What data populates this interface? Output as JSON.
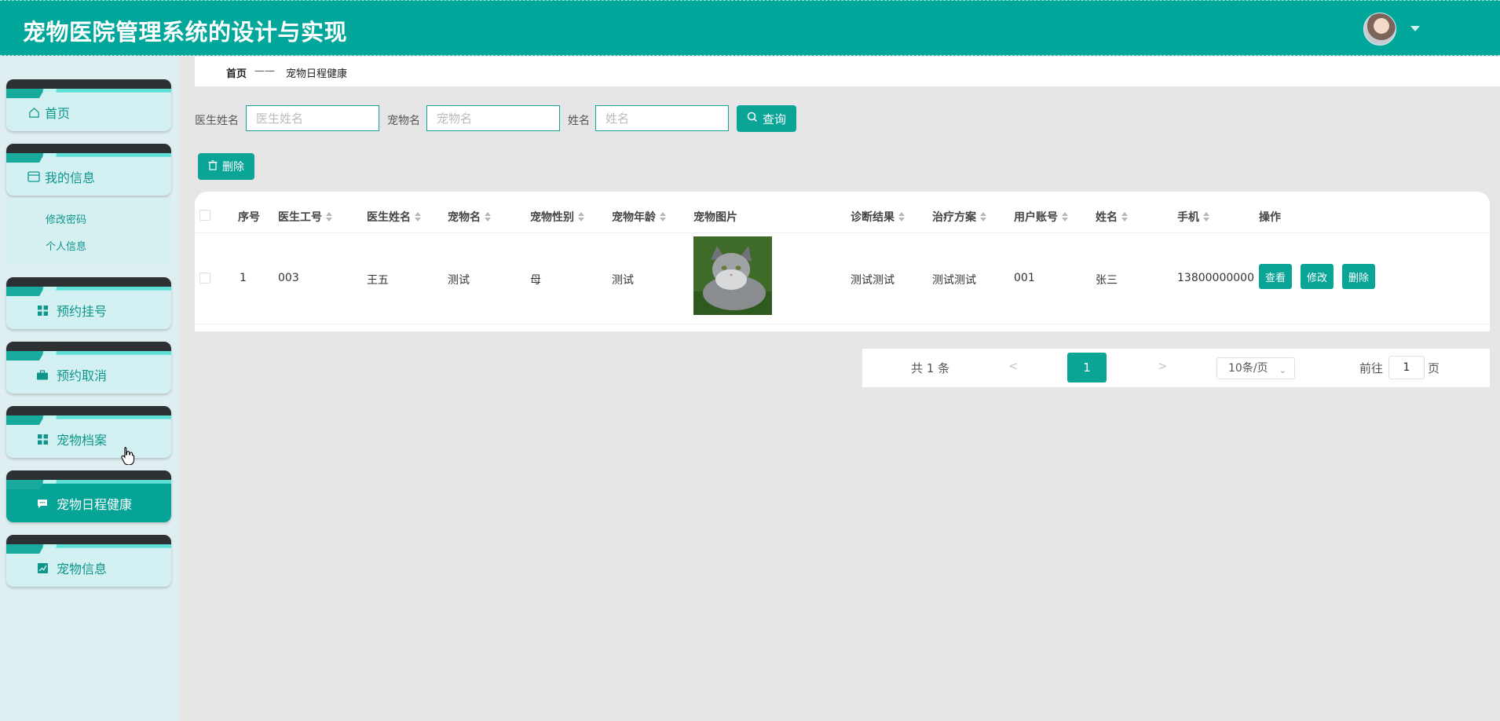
{
  "header": {
    "title": "宠物医院管理系统的设计与实现"
  },
  "sidebar": {
    "items": [
      {
        "label": "首页",
        "icon": "home-icon"
      },
      {
        "label": "我的信息",
        "icon": "wallet-icon"
      },
      {
        "label": "预约挂号",
        "icon": "grid-icon"
      },
      {
        "label": "预约取消",
        "icon": "briefcase-icon"
      },
      {
        "label": "宠物档案",
        "icon": "grid-icon"
      },
      {
        "label": "宠物日程健康",
        "icon": "chat-icon",
        "active": true
      },
      {
        "label": "宠物信息",
        "icon": "chart-icon"
      }
    ],
    "submenu": [
      "修改密码",
      "个人信息"
    ]
  },
  "breadcrumb": {
    "home": "首页",
    "sep": "——",
    "current": "宠物日程健康"
  },
  "search": {
    "fields": [
      {
        "label": "医生姓名",
        "placeholder": "医生姓名"
      },
      {
        "label": "宠物名",
        "placeholder": "宠物名"
      },
      {
        "label": "姓名",
        "placeholder": "姓名"
      }
    ],
    "button": "查询"
  },
  "toolbar": {
    "delete": "删除"
  },
  "table": {
    "headers": [
      "序号",
      "医生工号",
      "医生姓名",
      "宠物名",
      "宠物性别",
      "宠物年龄",
      "宠物图片",
      "诊断结果",
      "治疗方案",
      "用户账号",
      "姓名",
      "手机",
      "操作"
    ],
    "rows": [
      {
        "index": "1",
        "doctor_id": "003",
        "doctor_name": "王五",
        "pet_name": "测试",
        "pet_sex": "母",
        "pet_age": "测试",
        "diagnosis": "测试测试",
        "treatment": "测试测试",
        "user_account": "001",
        "name": "张三",
        "phone": "13800000000"
      }
    ],
    "actions": [
      "查看",
      "修改",
      "删除"
    ]
  },
  "pagination": {
    "total": "共 1 条",
    "prev": "<",
    "current": "1",
    "next": ">",
    "page_size": "10条/页",
    "goto_prefix": "前往",
    "goto_value": "1",
    "goto_suffix": "页"
  },
  "colors": {
    "primary": "#0aa597",
    "header": "#00a79a",
    "sidebar_dark": "#2e3134"
  }
}
